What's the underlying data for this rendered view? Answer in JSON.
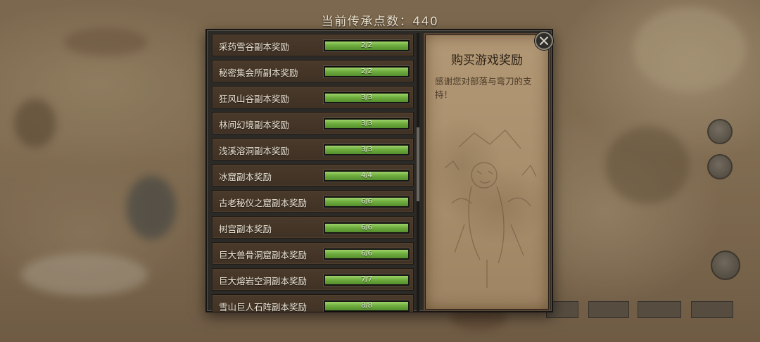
{
  "header": {
    "points_label": "当前传承点数：440"
  },
  "reward_list": [
    {
      "label": "采药雪谷副本奖励",
      "progress": "2/2",
      "fraction": 1.0
    },
    {
      "label": "秘密集会所副本奖励",
      "progress": "2/2",
      "fraction": 1.0
    },
    {
      "label": "狂风山谷副本奖励",
      "progress": "3/3",
      "fraction": 1.0
    },
    {
      "label": "林间幻境副本奖励",
      "progress": "3/3",
      "fraction": 1.0
    },
    {
      "label": "浅溪溶洞副本奖励",
      "progress": "3/3",
      "fraction": 1.0
    },
    {
      "label": "冰窟副本奖励",
      "progress": "4/4",
      "fraction": 1.0
    },
    {
      "label": "古老秘仪之窟副本奖励",
      "progress": "6/6",
      "fraction": 1.0
    },
    {
      "label": "树宫副本奖励",
      "progress": "6/6",
      "fraction": 1.0
    },
    {
      "label": "巨大兽骨洞窟副本奖励",
      "progress": "6/6",
      "fraction": 1.0
    },
    {
      "label": "巨大熔岩空洞副本奖励",
      "progress": "7/7",
      "fraction": 1.0
    },
    {
      "label": "雪山巨人石阵副本奖励",
      "progress": "8/8",
      "fraction": 1.0
    }
  ],
  "info_panel": {
    "title": "购买游戏奖励",
    "description": "感谢您对部落与弯刀的支持！"
  },
  "icons": {
    "close": "close-icon",
    "illustration": "tribal-sketch-illustration"
  },
  "colors": {
    "progress_green": "#6fae3f",
    "row_brown": "#4a3a2b",
    "panel_parchment": "#b29875"
  }
}
